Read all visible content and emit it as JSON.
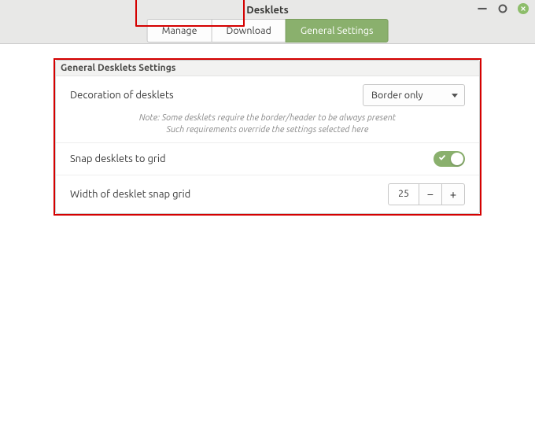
{
  "window": {
    "title": "Desklets"
  },
  "tabs": {
    "items": [
      {
        "label": "Manage"
      },
      {
        "label": "Download"
      },
      {
        "label": "General Settings"
      }
    ],
    "active_index": 2
  },
  "panel": {
    "title": "General Desklets Settings",
    "decoration": {
      "label": "Decoration of desklets",
      "value": "Border only"
    },
    "note_line1": "Note: Some desklets require the border/header to be always present",
    "note_line2": "Such requirements override the settings selected here",
    "snap": {
      "label": "Snap desklets to grid",
      "value": true
    },
    "grid_width": {
      "label": "Width of desklet snap grid",
      "value": "25",
      "minus": "−",
      "plus": "+"
    }
  }
}
